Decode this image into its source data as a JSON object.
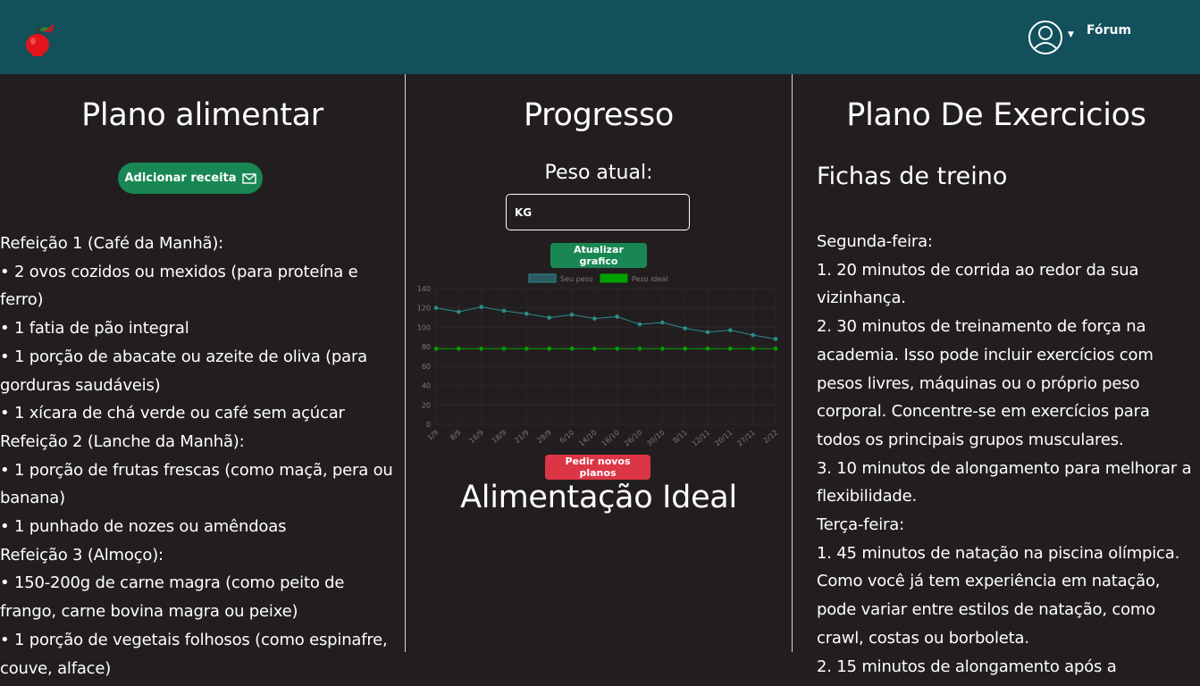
{
  "navbar": {
    "forum_label": "Fórum",
    "background": "#12505b"
  },
  "left": {
    "title": "Plano alimentar",
    "add_button_label": "Adicionar receita",
    "meal_plan": "Refeição 1 (Café da Manhã):\n• 2 ovos cozidos ou mexidos (para proteína e ferro)\n• 1 fatia de pão integral\n• 1 porção de abacate ou azeite de oliva (para gorduras saudáveis)\n• 1 xícara de chá verde ou café sem açúcar\nRefeição 2 (Lanche da Manhã):\n• 1 porção de frutas frescas (como maçã, pera ou banana)\n• 1 punhado de nozes ou amêndoas\nRefeição 3 (Almoço):\n• 150-200g de carne magra (como peito de frango, carne bovina magra ou peixe)\n• 1 porção de vegetais folhosos (como espinafre, couve, alface)"
  },
  "middle": {
    "title": "Progresso",
    "peso_label": "Peso atual:",
    "input_placeholder": "KG",
    "update_button_label": "Atualizar grafico",
    "request_button_label": "Pedir novos planos",
    "ideal_title": "Alimentação Ideal"
  },
  "right": {
    "title": "Plano De Exercicios",
    "subtitle": "Fichas de treino",
    "exercise_plan": "Segunda-feira:\n1. 20 minutos de corrida ao redor da sua vizinhança.\n2. 30 minutos de treinamento de força na academia. Isso pode incluir exercícios com pesos livres, máquinas ou o próprio peso corporal. Concentre-se em exercícios para todos os principais grupos musculares.\n3. 10 minutos de alongamento para melhorar a flexibilidade.\nTerça-feira:\n1. 45 minutos de natação na piscina olímpica. Como você já tem experiência em natação, pode variar entre estilos de natação, como crawl, costas ou borboleta.\n2. 15 minutos de alongamento após a"
  },
  "chart_data": {
    "type": "line",
    "categories": [
      "1/9",
      "8/9",
      "16/9",
      "18/9",
      "21/9",
      "29/9",
      "6/10",
      "14/10",
      "16/10",
      "26/10",
      "30/10",
      "8/11",
      "12/11",
      "20/11",
      "27/11",
      "2/12"
    ],
    "series": [
      {
        "name": "Seu peso",
        "color": "#2e8b8b",
        "values": [
          120,
          116,
          121,
          117,
          114,
          110,
          113,
          109,
          111,
          103,
          105,
          99,
          95,
          97,
          92,
          88
        ]
      },
      {
        "name": "Peso ideal",
        "color": "#00a000",
        "values": [
          78,
          78,
          78,
          78,
          78,
          78,
          78,
          78,
          78,
          78,
          78,
          78,
          78,
          78,
          78,
          78
        ]
      }
    ],
    "yticks": [
      "0",
      "20",
      "40",
      "60",
      "80",
      "100",
      "120",
      "140"
    ],
    "ylim": [
      0,
      140
    ],
    "legend": "top"
  }
}
